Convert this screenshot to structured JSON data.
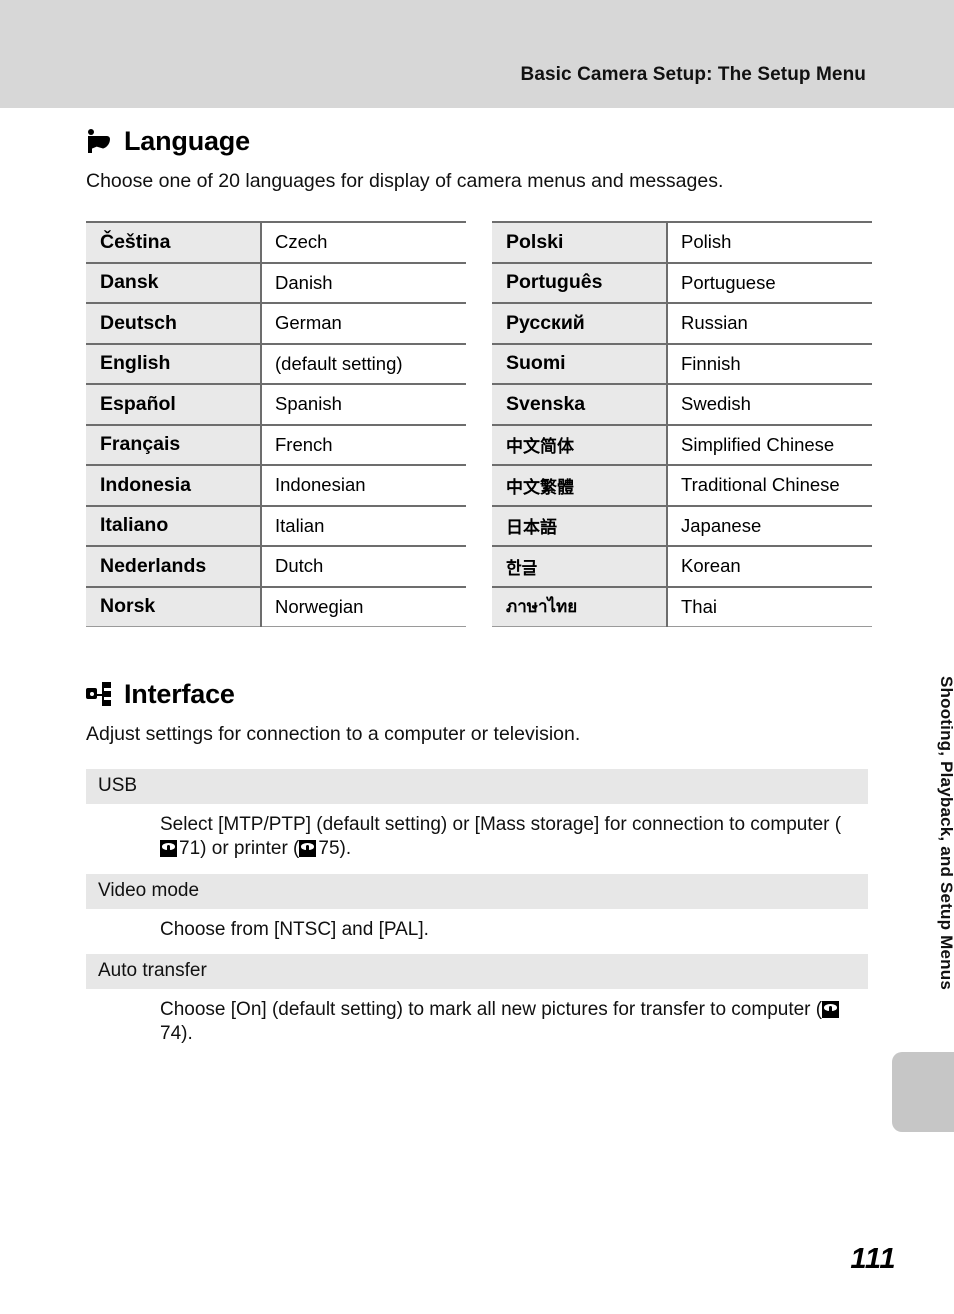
{
  "header": {
    "running_title": "Basic Camera Setup: The Setup Menu"
  },
  "language_section": {
    "icon": "flag-icon",
    "title": "Language",
    "description": "Choose one of 20 languages for display of camera menus and messages.",
    "left_table": [
      {
        "native": "Čeština",
        "english": "Czech"
      },
      {
        "native": "Dansk",
        "english": "Danish"
      },
      {
        "native": "Deutsch",
        "english": "German"
      },
      {
        "native": "English",
        "english": "(default setting)"
      },
      {
        "native": "Español",
        "english": "Spanish"
      },
      {
        "native": "Français",
        "english": "French"
      },
      {
        "native": "Indonesia",
        "english": "Indonesian"
      },
      {
        "native": "Italiano",
        "english": "Italian"
      },
      {
        "native": "Nederlands",
        "english": "Dutch"
      },
      {
        "native": "Norsk",
        "english": "Norwegian"
      }
    ],
    "right_table": [
      {
        "native": "Polski",
        "english": "Polish"
      },
      {
        "native": "Português",
        "english": "Portuguese"
      },
      {
        "native": "Русский",
        "english": "Russian"
      },
      {
        "native": "Suomi",
        "english": "Finnish"
      },
      {
        "native": "Svenska",
        "english": "Swedish"
      },
      {
        "native": "中文简体",
        "english": "Simplified Chinese"
      },
      {
        "native": "中文繁體",
        "english": "Traditional Chinese"
      },
      {
        "native": "日本語",
        "english": "Japanese"
      },
      {
        "native": "한글",
        "english": "Korean"
      },
      {
        "native": "ภาษาไทย",
        "english": "Thai"
      }
    ]
  },
  "interface_section": {
    "icon": "interface-hub-icon",
    "title": "Interface",
    "description": "Adjust settings for connection to a computer or television.",
    "items": [
      {
        "term": "USB",
        "definition_before": "Select [MTP/PTP] (default setting) or [Mass storage] for connection to computer (",
        "ref1": "71",
        "definition_middle": ") or printer (",
        "ref2": "75",
        "definition_after": ")."
      },
      {
        "term": "Video mode",
        "definition": "Choose from [NTSC] and [PAL]."
      },
      {
        "term": "Auto transfer",
        "definition_before": "Choose [On] (default setting) to mark all new pictures for transfer to computer (",
        "ref1": "74",
        "definition_after": ")."
      }
    ]
  },
  "side": {
    "running_label": "Shooting, Playback, and Setup Menus"
  },
  "folio": {
    "page_number": "111"
  }
}
